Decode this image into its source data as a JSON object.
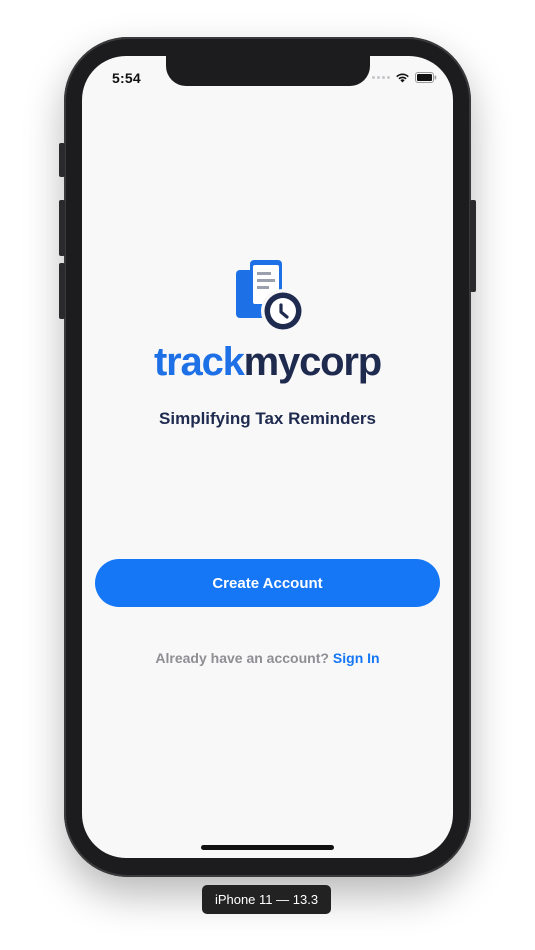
{
  "device": {
    "label": "iPhone 11 — 13.3"
  },
  "status_bar": {
    "time": "5:54",
    "icons": [
      "signal-dots-icon",
      "wifi-icon",
      "battery-icon"
    ]
  },
  "branding": {
    "logo_icon": "document-clock-icon",
    "name_part1": "track",
    "name_part2": "mycorp",
    "tagline": "Simplifying Tax Reminders"
  },
  "actions": {
    "create_account_label": "Create Account",
    "signin_prompt": "Already have an account?",
    "signin_link": "Sign In"
  },
  "colors": {
    "primary": "#1577f6",
    "brand_blue": "#1e70e6",
    "brand_navy": "#1f2a4f",
    "muted_text": "#8e8e93",
    "screen_background": "#f8f8f9"
  }
}
